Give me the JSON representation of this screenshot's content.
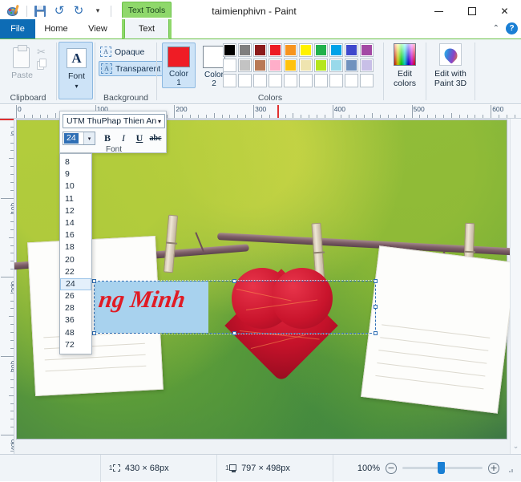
{
  "window": {
    "title": "taimienphivn - Paint",
    "contextual_tab_header": "Text Tools",
    "minimize": "—",
    "maximize": "□",
    "close": "✕",
    "collapse_ribbon": "⌃",
    "help": "?"
  },
  "quick_access": {
    "paint_icon": "paint-palette-icon",
    "save": "save-icon",
    "undo": "↺",
    "redo": "↻",
    "customize": "▾"
  },
  "tabs": [
    {
      "label": "File",
      "active": false,
      "style": "file"
    },
    {
      "label": "Home",
      "active": false,
      "style": "normal"
    },
    {
      "label": "View",
      "active": false,
      "style": "normal"
    },
    {
      "label": "Text",
      "active": true,
      "style": "contextual"
    }
  ],
  "ribbon": {
    "clipboard": {
      "group_label": "Clipboard",
      "paste_label": "Paste",
      "cut_icon": "scissors-icon",
      "copy_icon": "copy-icon"
    },
    "font_group": {
      "group_label": "Font",
      "button_label": "Font",
      "glyph": "A",
      "caret": "▾"
    },
    "background": {
      "group_label": "Background",
      "opaque_label": "Opaque",
      "transparent_label": "Transparent",
      "opaque_glyph": "A",
      "transparent_glyph": "A",
      "selected": "Transparent"
    },
    "colors": {
      "group_label": "Colors",
      "color1_label_line1": "Color",
      "color1_label_line2": "1",
      "color2_label_line1": "Color",
      "color2_label_line2": "2",
      "color1_value": "#ef1c25",
      "color2_value": "#ffffff",
      "palette_row1": [
        "#000000",
        "#7f7f7f",
        "#8b1a1a",
        "#ed1c24",
        "#f7941e",
        "#fff200",
        "#22b14c",
        "#00a2e8",
        "#3f48cc",
        "#a349a4"
      ],
      "palette_row2": [
        "#ffffff",
        "#c3c3c3",
        "#b97a57",
        "#ffaec9",
        "#ffc20e",
        "#efe4b0",
        "#b5e61d",
        "#99d9ea",
        "#7092be",
        "#c8bfe7"
      ],
      "palette_row3": [
        "#ffffff",
        "#ffffff",
        "#ffffff",
        "#ffffff",
        "#ffffff",
        "#ffffff",
        "#ffffff",
        "#ffffff",
        "#ffffff",
        "#ffffff"
      ]
    },
    "edit_colors": {
      "label_line1": "Edit",
      "label_line2": "colors",
      "icon": "rainbow-gradient-icon"
    },
    "paint3d": {
      "label_line1": "Edit with",
      "label_line2": "Paint 3D",
      "icon": "paint3d-icon"
    }
  },
  "font_popup": {
    "font_name": "UTM ThuPhap Thien An",
    "font_name_caret": "▾",
    "size_value": "24",
    "size_caret": "▾",
    "bold": "B",
    "italic": "I",
    "underline": "U",
    "strikethrough": "abc",
    "group_label": "Font",
    "size_options": [
      "8",
      "9",
      "10",
      "11",
      "12",
      "14",
      "16",
      "18",
      "20",
      "22",
      "24",
      "26",
      "28",
      "36",
      "48",
      "72"
    ],
    "size_selected": "24"
  },
  "rulers": {
    "horizontal_ticks": [
      "0",
      "100",
      "200",
      "300",
      "400",
      "500",
      "600"
    ],
    "vertical_ticks": [
      "0",
      "100",
      "200",
      "300",
      "400"
    ]
  },
  "canvas": {
    "text_content": "ng Minh",
    "selection_label": "text-selection-box"
  },
  "scrollbars": {
    "left_arrow": "‹",
    "right_arrow": "›",
    "down_arrow": "⌄"
  },
  "status_bar": {
    "selection_size": "430 × 68px",
    "image_size": "797 × 498px",
    "zoom_level": "100%",
    "zoom_out": "−",
    "zoom_in": "+"
  }
}
